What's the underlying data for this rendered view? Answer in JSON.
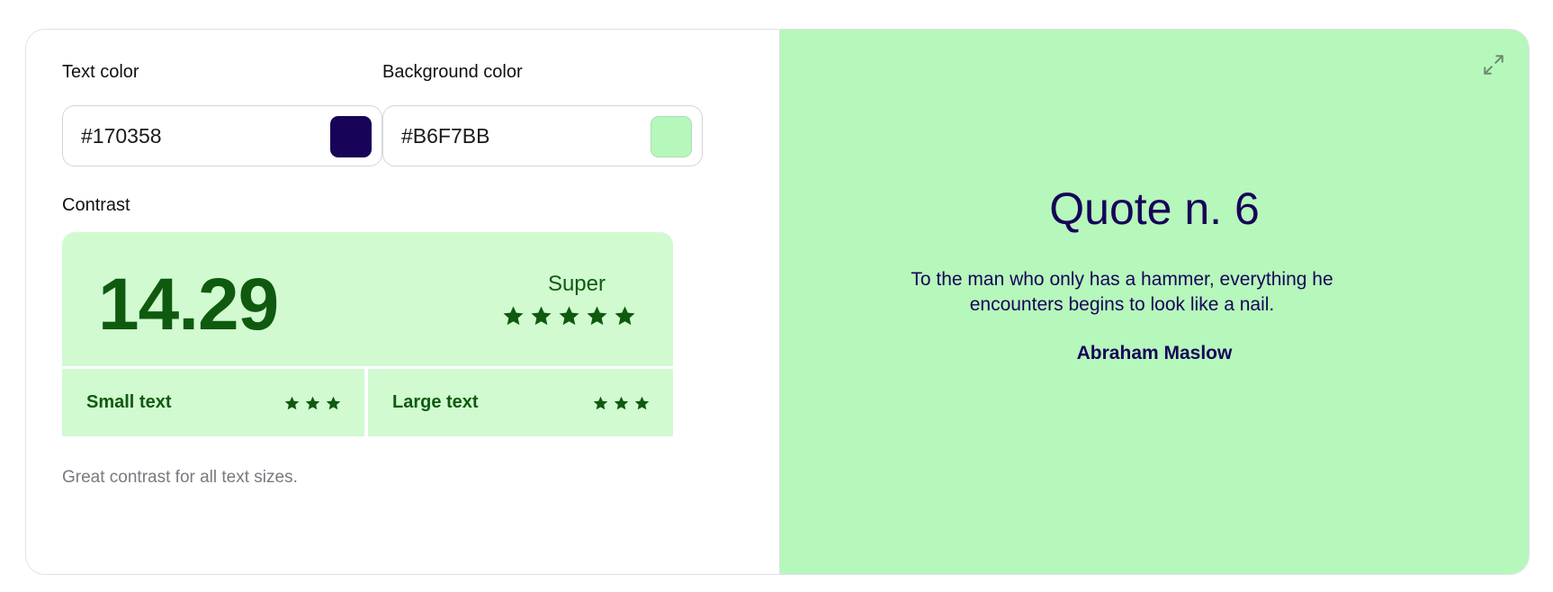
{
  "colors": {
    "text_color_label": "Text color",
    "text_color_value": "#170358",
    "background_color_label": "Background color",
    "background_color_value": "#B6F7BB",
    "contrast_fill": "#D1FAD1",
    "contrast_text": "#0f5a0f"
  },
  "contrast": {
    "label": "Contrast",
    "ratio": "14.29",
    "rating": "Super",
    "rating_stars": 5,
    "small_text_label": "Small text",
    "small_text_stars": 3,
    "large_text_label": "Large text",
    "large_text_stars": 3,
    "note": "Great contrast for all text sizes."
  },
  "preview": {
    "title": "Quote n. 6",
    "quote": "To the man who only has a hammer, everything he encounters begins to look like a nail.",
    "author": "Abraham Maslow",
    "expand_icon": "expand-icon"
  }
}
